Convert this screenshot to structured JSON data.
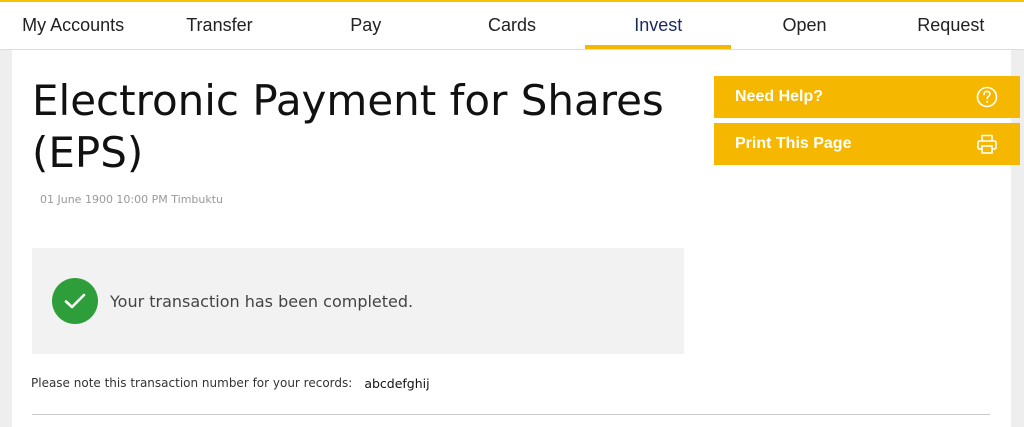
{
  "nav": {
    "items": [
      {
        "label": "My Accounts",
        "name": "nav-my-accounts"
      },
      {
        "label": "Transfer",
        "name": "nav-transfer"
      },
      {
        "label": "Pay",
        "name": "nav-pay"
      },
      {
        "label": "Cards",
        "name": "nav-cards"
      },
      {
        "label": "Invest",
        "name": "nav-invest"
      },
      {
        "label": "Open",
        "name": "nav-open"
      },
      {
        "label": "Request",
        "name": "nav-request"
      }
    ],
    "active": "Invest"
  },
  "page": {
    "title": "Electronic Payment for Shares (EPS)",
    "timestamp": "01 June 1900 10:00 PM Timbuktu"
  },
  "success": {
    "icon": "checkmark-icon",
    "message": "Your transaction has been completed."
  },
  "note": {
    "label": "Please note this transaction number for your records:",
    "transaction_number": "abcdefghij"
  },
  "sidebar": {
    "help_label": "Need Help?",
    "help_icon": "question-circle-icon",
    "print_label": "Print This Page",
    "print_icon": "printer-icon"
  },
  "colors": {
    "accent": "#f5b700",
    "success": "#2e9e3a",
    "active_nav_text": "#1a2a5e"
  }
}
